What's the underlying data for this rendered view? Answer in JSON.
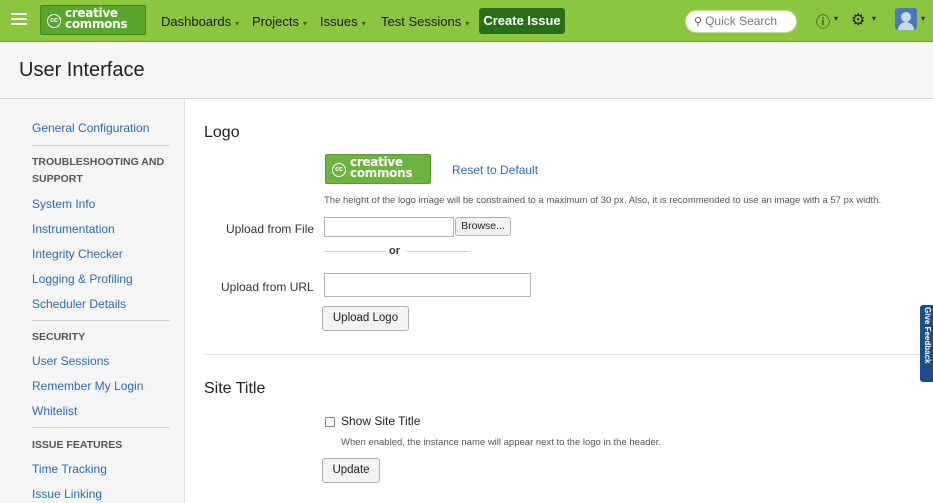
{
  "nav": {
    "logo_line1": "creative",
    "logo_line2": "commons",
    "logo_cc": "cc",
    "dashboards": "Dashboards",
    "projects": "Projects",
    "issues": "Issues",
    "test_sessions": "Test Sessions",
    "create_issue": "Create Issue",
    "search_placeholder": "Quick Search",
    "caret": "▾",
    "help_icon": "question-circle-icon",
    "settings_icon": "gear-icon",
    "accent_color": "#8cc63f",
    "create_color": "#2b6e1a"
  },
  "header": {
    "title": "User Interface"
  },
  "sidebar": {
    "general": "General Configuration",
    "troubleshooting_heading": "TROUBLESHOOTING AND SUPPORT",
    "troubleshooting_items": [
      "System Info",
      "Instrumentation",
      "Integrity Checker",
      "Logging & Profiling",
      "Scheduler Details"
    ],
    "security_heading": "SECURITY",
    "security_items": [
      "User Sessions",
      "Remember My Login",
      "Whitelist"
    ],
    "issue_features_heading": "ISSUE FEATURES",
    "issue_features_items": [
      "Time Tracking",
      "Issue Linking"
    ]
  },
  "logo_section": {
    "heading": "Logo",
    "reset_link": "Reset to Default",
    "description": "The height of the logo image will be constrained to a maximum of 30 px. Also, it is recommended to use an image with a 57 px width.",
    "upload_file_label": "Upload from File",
    "browse_button": "Browse...",
    "or": "or",
    "upload_url_label": "Upload from URL",
    "upload_url_value": "",
    "upload_logo_button": "Upload Logo"
  },
  "site_title_section": {
    "heading": "Site Title",
    "checkbox_label": "Show Site Title",
    "checkbox_checked": false,
    "description": "When enabled, the instance name will appear next to the logo in the header.",
    "update_button": "Update"
  },
  "feedback_tab": {
    "label": "Give Feedback"
  }
}
